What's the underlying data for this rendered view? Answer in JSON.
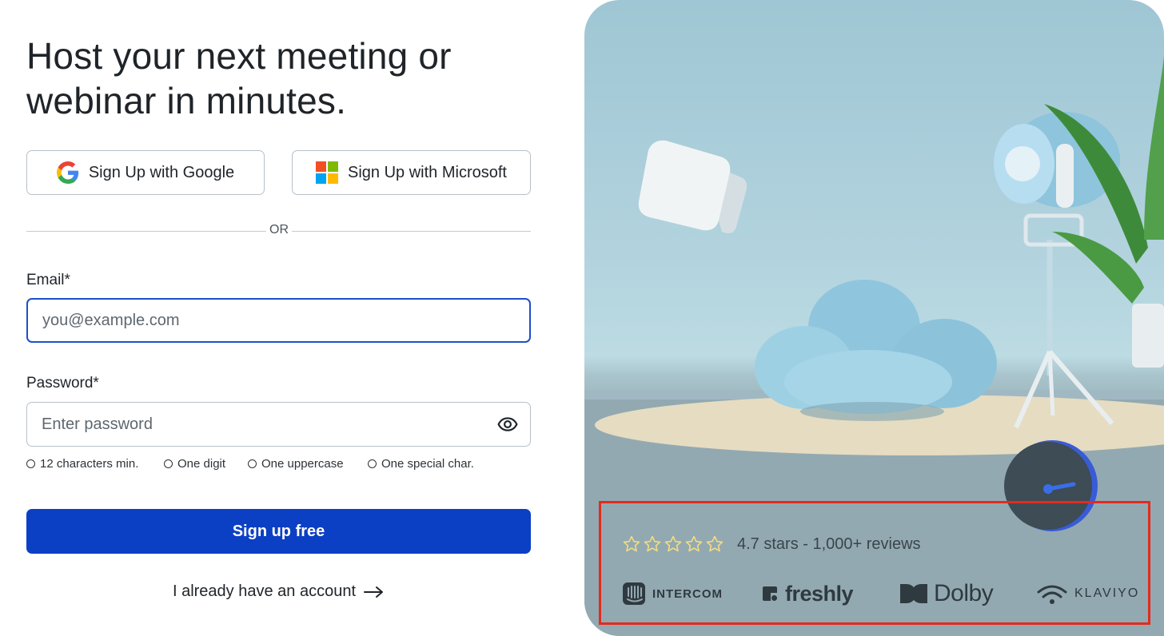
{
  "headline": {
    "line1": "Host your next meeting or",
    "line2": "webinar in minutes."
  },
  "oauth": {
    "google_label": "Sign Up with Google",
    "microsoft_label": "Sign Up with Microsoft"
  },
  "divider": {
    "label": "OR"
  },
  "email": {
    "label": "Email*",
    "placeholder": "you@example.com",
    "value": ""
  },
  "password": {
    "label": "Password*",
    "placeholder": "Enter password",
    "value": "",
    "requirements": [
      "12 characters min.",
      "One digit",
      "One uppercase",
      "One special char."
    ]
  },
  "cta": {
    "label": "Sign up free"
  },
  "login_link": {
    "label": "I already have an account"
  },
  "social_proof": {
    "stars_filled": 0,
    "stars_total": 5,
    "rating_text": "4.7 stars - 1,000+ reviews",
    "logos": [
      {
        "name": "INTERCOM",
        "icon": "intercom-icon"
      },
      {
        "name": "freshly",
        "icon": "freshly-icon"
      },
      {
        "name": "Dolby",
        "icon": "dolby-icon"
      },
      {
        "name": "KLAVIYO",
        "icon": "klaviyo-icon"
      }
    ]
  },
  "colors": {
    "primary": "#0b3fc4",
    "focus_border": "#1e4fc9",
    "highlight_box": "#e42a1d",
    "star_outline": "#f2dc82"
  }
}
